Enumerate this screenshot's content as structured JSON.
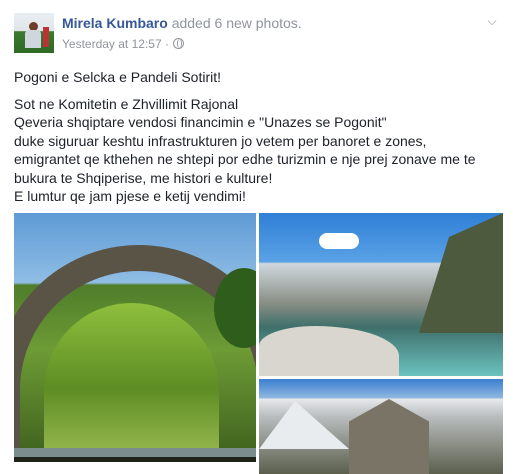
{
  "post": {
    "author": "Mirela Kumbaro",
    "action": "added 6 new photos.",
    "timestamp": "Yesterday at 12:57 ·",
    "audience_icon": "globe-icon",
    "menu_icon": "chevron-down-icon",
    "text": {
      "line1": "Pogoni e Selcka e Pandeli Sotirit!",
      "line2": "Sot ne Komitetin e Zhvillimit Rajonal",
      "line3": "Qeveria shqiptare vendosi financimin e \"Unazes se Pogonit\"",
      "line4": "duke siguruar keshtu infrastrukturen jo vetem per banoret e zones,",
      "line5": "emigrantet qe kthehen ne shtepi por edhe turizmin e nje prej zonave me te",
      "line6": "bukura te Shqiperise, me histori e kulture!",
      "line7": "E lumtur qe jam pjese e ketij vendimi!"
    }
  },
  "colors": {
    "author": "#365899",
    "meta": "#90949c",
    "text": "#1d2129"
  }
}
